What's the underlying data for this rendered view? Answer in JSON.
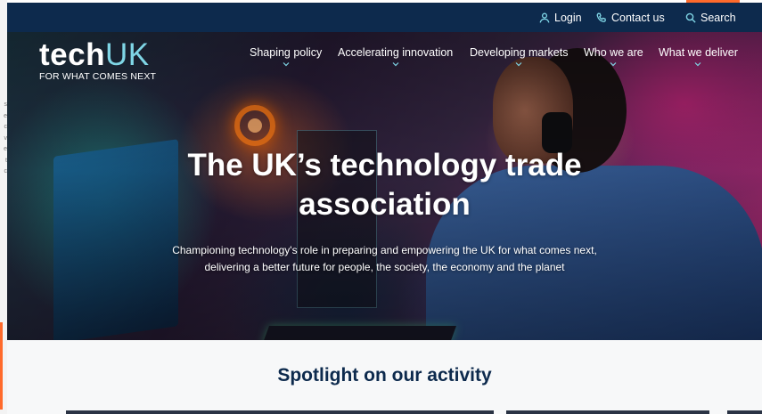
{
  "utility": {
    "login": "Login",
    "contact": "Contact us",
    "search": "Search"
  },
  "logo": {
    "tech": "tech",
    "uk": "UK",
    "tagline": "FOR WHAT COMES NEXT"
  },
  "nav": [
    {
      "label": "Shaping policy"
    },
    {
      "label": "Accelerating innovation"
    },
    {
      "label": "Developing markets"
    },
    {
      "label": "Who we are"
    },
    {
      "label": "What we deliver"
    }
  ],
  "hero": {
    "title_line1": "The UK’s technology trade",
    "title_line2": "association",
    "subtitle_line1": "Championing technology's role in preparing and empowering the UK for what comes next,",
    "subtitle_line2": "delivering a better future for people, the society, the economy and the planet"
  },
  "spotlight": {
    "title": "Spotlight on our activity"
  },
  "edge_letters": [
    "s",
    "e",
    "c",
    "v",
    "e",
    "t",
    "c"
  ],
  "colors": {
    "navy": "#0d2a4d",
    "accent_teal": "#7fd6e6",
    "accent_orange": "#ff6a2b"
  }
}
